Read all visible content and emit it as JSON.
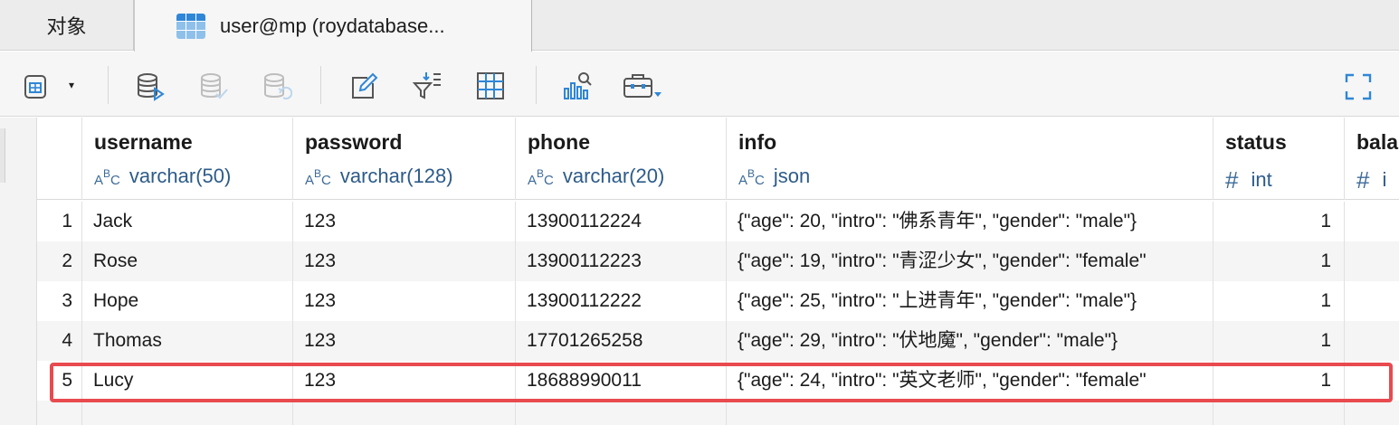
{
  "tabs": [
    {
      "label": "对象"
    },
    {
      "label": "user@mp (roydatabase..."
    }
  ],
  "toolbar": {
    "icons": [
      "add-record-icon",
      "dropdown-arrow-icon",
      "apply-changes-icon",
      "commit-icon",
      "revert-icon",
      "edit-icon",
      "filter-sort-icon",
      "grid-view-icon",
      "chart-analysis-icon",
      "toolbox-icon",
      "fullscreen-icon"
    ],
    "dropdown_glyph": "▾"
  },
  "columns": [
    {
      "name": "username",
      "type_prefix": "ABC",
      "type": "varchar(50)"
    },
    {
      "name": "password",
      "type_prefix": "ABC",
      "type": "varchar(128)"
    },
    {
      "name": "phone",
      "type_prefix": "ABC",
      "type": "varchar(20)"
    },
    {
      "name": "info",
      "type_prefix": "ABC",
      "type": "json"
    },
    {
      "name": "status",
      "type_prefix": "#",
      "type": "int"
    },
    {
      "name": "bala",
      "type_prefix": "#",
      "type": "i"
    }
  ],
  "rows": [
    {
      "num": "1",
      "username": "Jack",
      "password": "123",
      "phone": "13900112224",
      "info": "{\"age\": 20, \"intro\": \"佛系青年\", \"gender\": \"male\"}",
      "status": "1"
    },
    {
      "num": "2",
      "username": "Rose",
      "password": "123",
      "phone": "13900112223",
      "info": "{\"age\": 19, \"intro\": \"青涩少女\", \"gender\": \"female\"",
      "status": "1"
    },
    {
      "num": "3",
      "username": "Hope",
      "password": "123",
      "phone": "13900112222",
      "info": "{\"age\": 25, \"intro\": \"上进青年\", \"gender\": \"male\"}",
      "status": "1"
    },
    {
      "num": "4",
      "username": "Thomas",
      "password": "123",
      "phone": "17701265258",
      "info": "{\"age\": 29, \"intro\": \"伏地魔\", \"gender\": \"male\"}",
      "status": "1"
    },
    {
      "num": "5",
      "username": "Lucy",
      "password": "123",
      "phone": "18688990011",
      "info": "{\"age\": 24, \"intro\": \"英文老师\", \"gender\": \"female\"",
      "status": "1"
    }
  ],
  "highlight_color": "#e84a4f",
  "type_color": "#2d5b8a",
  "accent_color": "#2f86d6"
}
